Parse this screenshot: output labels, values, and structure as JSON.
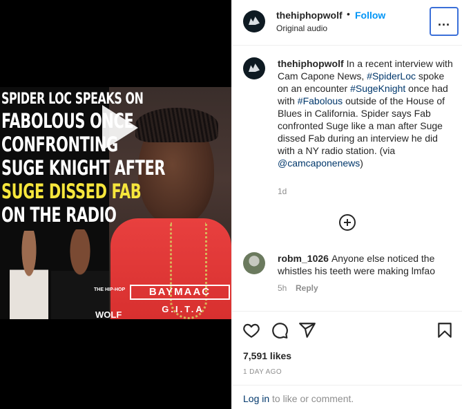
{
  "media": {
    "headline": [
      "SPIDER LOC SPEAKS ON",
      "FABOLOUS ONCE",
      "CONFRONTING",
      "SUGE KNIGHT AFTER",
      "SUGE DISSED FAB",
      "ON THE RADIO"
    ],
    "shirt_line1": "BAYMAAC",
    "shirt_line2": "G.I.T.A",
    "logo_small": "THE HIP-HOP",
    "logo_big": "WOLF"
  },
  "header": {
    "username": "thehiphopwolf",
    "separator": "•",
    "follow_label": "Follow",
    "audio_label": "Original audio",
    "more_label": "..."
  },
  "caption": {
    "username": "thehiphopwolf",
    "seg1": "In a recent interview with Cam Capone News, ",
    "tag1": "#SpiderLoc",
    "seg2": " spoke on an encounter ",
    "tag2": "#SugeKnight",
    "seg3": " once had with ",
    "tag3": "#Fabolous",
    "seg4": " outside of the House of Blues in California. Spider says Fab confronted Suge like a man after Suge dissed Fab during an interview he did with a NY radio station. (via ",
    "mention": "@camcaponenews",
    "seg5": ")",
    "time": "1d"
  },
  "comment": {
    "username": "robm_1026",
    "text": "Anyone else noticed the whistles his teeth were making lmfao",
    "time": "5h",
    "reply_label": "Reply"
  },
  "actions": {
    "likes": "7,591 likes",
    "date": "1 DAY AGO"
  },
  "login": {
    "link_label": "Log in",
    "rest_text": " to like or comment."
  },
  "colors": {
    "link_blue": "#0095f6",
    "tag_blue": "#00376b",
    "muted": "#8e8e8e",
    "headline_yellow": "#f6e63c"
  },
  "icons": [
    "play-icon",
    "more-options-icon",
    "add-comment-icon",
    "heart-icon",
    "comment-icon",
    "share-icon",
    "bookmark-icon"
  ]
}
